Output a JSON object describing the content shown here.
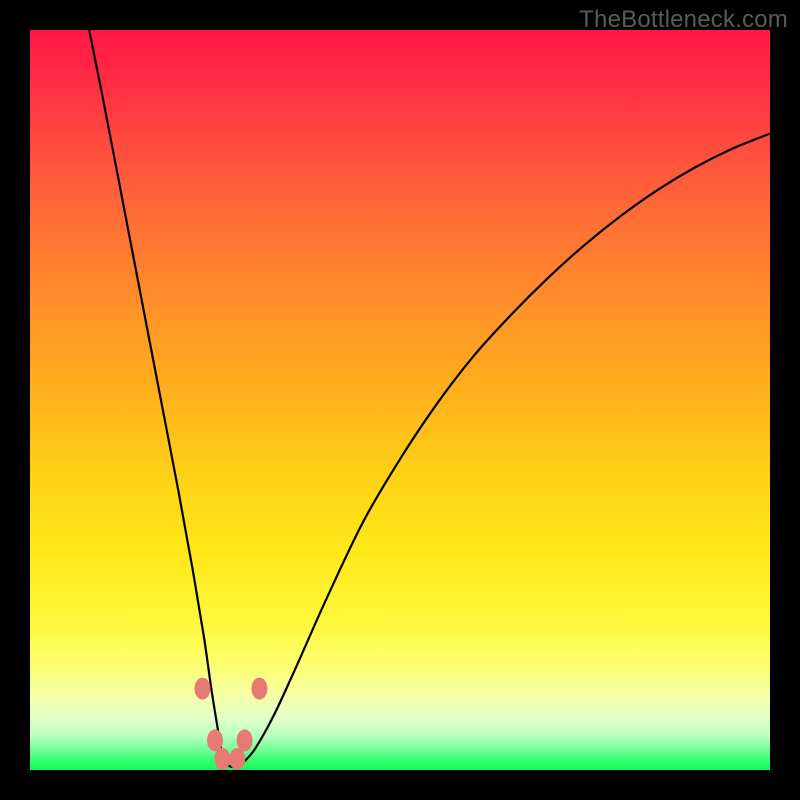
{
  "watermark": "TheBottleneck.com",
  "chart_data": {
    "type": "line",
    "title": "",
    "xlabel": "",
    "ylabel": "",
    "xlim": [
      0,
      100
    ],
    "ylim": [
      0,
      100
    ],
    "x": [
      8,
      10,
      12.5,
      15,
      17.5,
      20,
      22,
      23.5,
      24.5,
      25.3,
      25.8,
      26.3,
      27,
      28,
      29,
      30.5,
      33,
      36,
      40,
      45,
      50,
      55,
      60,
      65,
      70,
      75,
      80,
      85,
      90,
      95,
      100
    ],
    "y": [
      100,
      90,
      77,
      64,
      51,
      38,
      27,
      18,
      11,
      6,
      3,
      1.2,
      0.5,
      0.5,
      1.2,
      3,
      7.5,
      14,
      23,
      33.5,
      42,
      49.5,
      56,
      61.5,
      66.5,
      71,
      75,
      78.5,
      81.5,
      84,
      86
    ],
    "background_gradient_stops": [
      {
        "pos": 0.0,
        "color": "#ff1846"
      },
      {
        "pos": 0.5,
        "color": "#ffb41c"
      },
      {
        "pos": 0.8,
        "color": "#fff83c"
      },
      {
        "pos": 0.95,
        "color": "#b6ffbd"
      },
      {
        "pos": 1.0,
        "color": "#16f95b"
      }
    ],
    "markers": [
      {
        "x": 23.3,
        "y": 11.0
      },
      {
        "x": 25.0,
        "y": 4.0
      },
      {
        "x": 26.0,
        "y": 1.5
      },
      {
        "x": 28.0,
        "y": 1.5
      },
      {
        "x": 29.0,
        "y": 4.0
      },
      {
        "x": 31.0,
        "y": 11.0
      }
    ],
    "marker_color": "#e77a72"
  }
}
